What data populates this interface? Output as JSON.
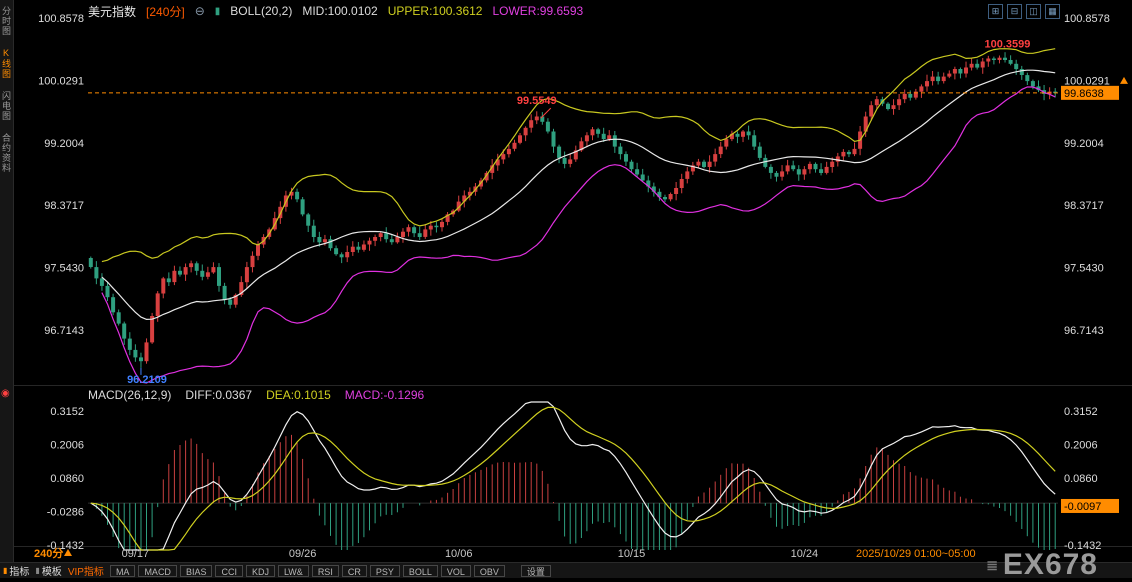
{
  "sidebar": {
    "tabs": [
      {
        "label": "分时图",
        "active": false
      },
      {
        "label": "K线图",
        "active": true
      },
      {
        "label": "闪电图",
        "active": false
      },
      {
        "label": "合约资料",
        "active": false
      }
    ],
    "indicator_dot": "◉"
  },
  "topbar": {
    "title": "美元指数",
    "period": "[240分]",
    "minus_icon": "⊖",
    "boll_icon": "▮",
    "boll": {
      "label": "BOLL(20,2)",
      "mid": "MID:100.0102",
      "upper": "UPPER:100.3612",
      "lower": "LOWER:99.6593"
    },
    "window_icons": [
      "⊞",
      "⊟",
      "◫",
      "▦"
    ]
  },
  "macd_panel": {
    "header": {
      "label": "MACD(26,12,9)",
      "diff": "DIFF:0.0367",
      "dea": "DEA:0.1015",
      "macd": "MACD:-0.1296"
    }
  },
  "timeline": {
    "period": "240分"
  },
  "toolbar": {
    "tabs": [
      "指标",
      "模板",
      "VIP指标"
    ],
    "indicators": [
      "MA",
      "MACD",
      "BIAS",
      "CCI",
      "KDJ",
      "LW&",
      "RSI",
      "CR",
      "PSY",
      "BOLL",
      "VOL",
      "OBV"
    ],
    "settings": "设置"
  },
  "watermark": {
    "icon": "≣",
    "text": "EX678"
  },
  "colors": {
    "background": "#000000",
    "accent_orange": "#ff8c00",
    "candle_up": "#d84040",
    "candle_down": "#2fa080",
    "boll_upper": "#c8c820",
    "boll_mid": "#e8e8e8",
    "boll_lower": "#e030e0",
    "diff_line": "#f0f0f0",
    "dea_line": "#d0d020",
    "hist_pos": "#c84040",
    "hist_neg": "#2fa080",
    "annotation_high": "#ff4040",
    "annotation_low": "#4080ff",
    "axis_text": "#dedede"
  },
  "chart_data": {
    "type": "candlestick",
    "symbol": "美元指数",
    "interval": "240分",
    "ylim": [
      96.2109,
      100.8578
    ],
    "indicators": {
      "boll": {
        "period": 20,
        "k": 2,
        "mid": 100.0102,
        "upper": 100.3612,
        "lower": 99.6593
      },
      "macd": {
        "fast": 12,
        "slow": 26,
        "signal": 9,
        "diff": 0.0367,
        "dea": 0.1015,
        "macd": -0.1296
      }
    },
    "price_ticks": [
      {
        "v": 100.8578,
        "label": "100.8578"
      },
      {
        "v": 100.0291,
        "label": "100.0291"
      },
      {
        "v": 99.2004,
        "label": "99.2004"
      },
      {
        "v": 98.3717,
        "label": "98.3717"
      },
      {
        "v": 97.543,
        "label": "97.5430"
      },
      {
        "v": 96.7143,
        "label": "96.7143"
      }
    ],
    "macd_ticks": [
      {
        "v": 0.3152,
        "label": "0.3152"
      },
      {
        "v": 0.2006,
        "label": "0.2006"
      },
      {
        "v": 0.086,
        "label": "0.0860"
      },
      {
        "v": -0.0286,
        "label": "-0.0286"
      },
      {
        "v": -0.1432,
        "label": "-0.1432"
      }
    ],
    "closes": [
      97.55,
      97.4,
      97.3,
      97.15,
      96.95,
      96.8,
      96.6,
      96.45,
      96.35,
      96.3,
      96.55,
      96.9,
      97.2,
      97.4,
      97.35,
      97.5,
      97.45,
      97.55,
      97.6,
      97.5,
      97.42,
      97.48,
      97.55,
      97.3,
      97.12,
      97.05,
      97.18,
      97.35,
      97.55,
      97.7,
      97.85,
      97.95,
      98.05,
      98.2,
      98.35,
      98.5,
      98.55,
      98.45,
      98.25,
      98.1,
      97.95,
      97.88,
      97.92,
      97.8,
      97.72,
      97.68,
      97.75,
      97.82,
      97.78,
      97.85,
      97.9,
      97.95,
      98.0,
      97.92,
      97.88,
      97.95,
      98.02,
      98.08,
      98.0,
      97.95,
      98.05,
      98.1,
      98.08,
      98.15,
      98.25,
      98.3,
      98.42,
      98.5,
      98.55,
      98.62,
      98.7,
      98.8,
      98.9,
      98.98,
      99.05,
      99.12,
      99.2,
      99.3,
      99.4,
      99.5,
      99.55,
      99.48,
      99.35,
      99.15,
      99.0,
      98.92,
      98.98,
      99.1,
      99.22,
      99.3,
      99.38,
      99.32,
      99.25,
      99.3,
      99.15,
      99.05,
      98.95,
      98.85,
      98.78,
      98.7,
      98.62,
      98.55,
      98.48,
      98.45,
      98.52,
      98.6,
      98.72,
      98.82,
      98.9,
      98.95,
      98.88,
      98.95,
      99.05,
      99.15,
      99.25,
      99.32,
      99.28,
      99.35,
      99.3,
      99.15,
      99.0,
      98.88,
      98.8,
      98.75,
      98.82,
      98.9,
      98.85,
      98.78,
      98.85,
      98.92,
      98.85,
      98.8,
      98.88,
      98.95,
      99.02,
      99.08,
      99.05,
      99.12,
      99.35,
      99.55,
      99.7,
      99.78,
      99.72,
      99.65,
      99.7,
      99.78,
      99.85,
      99.8,
      99.88,
      99.95,
      100.02,
      100.08,
      100.02,
      100.08,
      100.12,
      100.18,
      100.12,
      100.2,
      100.25,
      100.2,
      100.28,
      100.32,
      100.3,
      100.33,
      100.3,
      100.25,
      100.18,
      100.1,
      100.02,
      99.95,
      99.9,
      99.85,
      99.88,
      99.86
    ],
    "annotations": {
      "max_high": {
        "value": 100.3599,
        "label": "100.3599"
      },
      "peak": {
        "value": 99.5549,
        "label": "99.5549",
        "bar": 80
      },
      "min_low": {
        "value": 96.2109,
        "label": "96.2109",
        "bar": 9
      },
      "last_price": {
        "value": 99.8638,
        "label": "99.8638"
      },
      "macd_last": {
        "value": -0.0097,
        "label": "-0.0097"
      }
    },
    "x_labels": [
      {
        "text": "09/17",
        "bar": 8
      },
      {
        "text": "09/26",
        "bar": 38
      },
      {
        "text": "10/06",
        "bar": 66
      },
      {
        "text": "10/15",
        "bar": 97
      },
      {
        "text": "10/24",
        "bar": 128
      }
    ],
    "current_session": {
      "text": "2025/10/29 01:00~05:00",
      "bar": 148
    }
  }
}
